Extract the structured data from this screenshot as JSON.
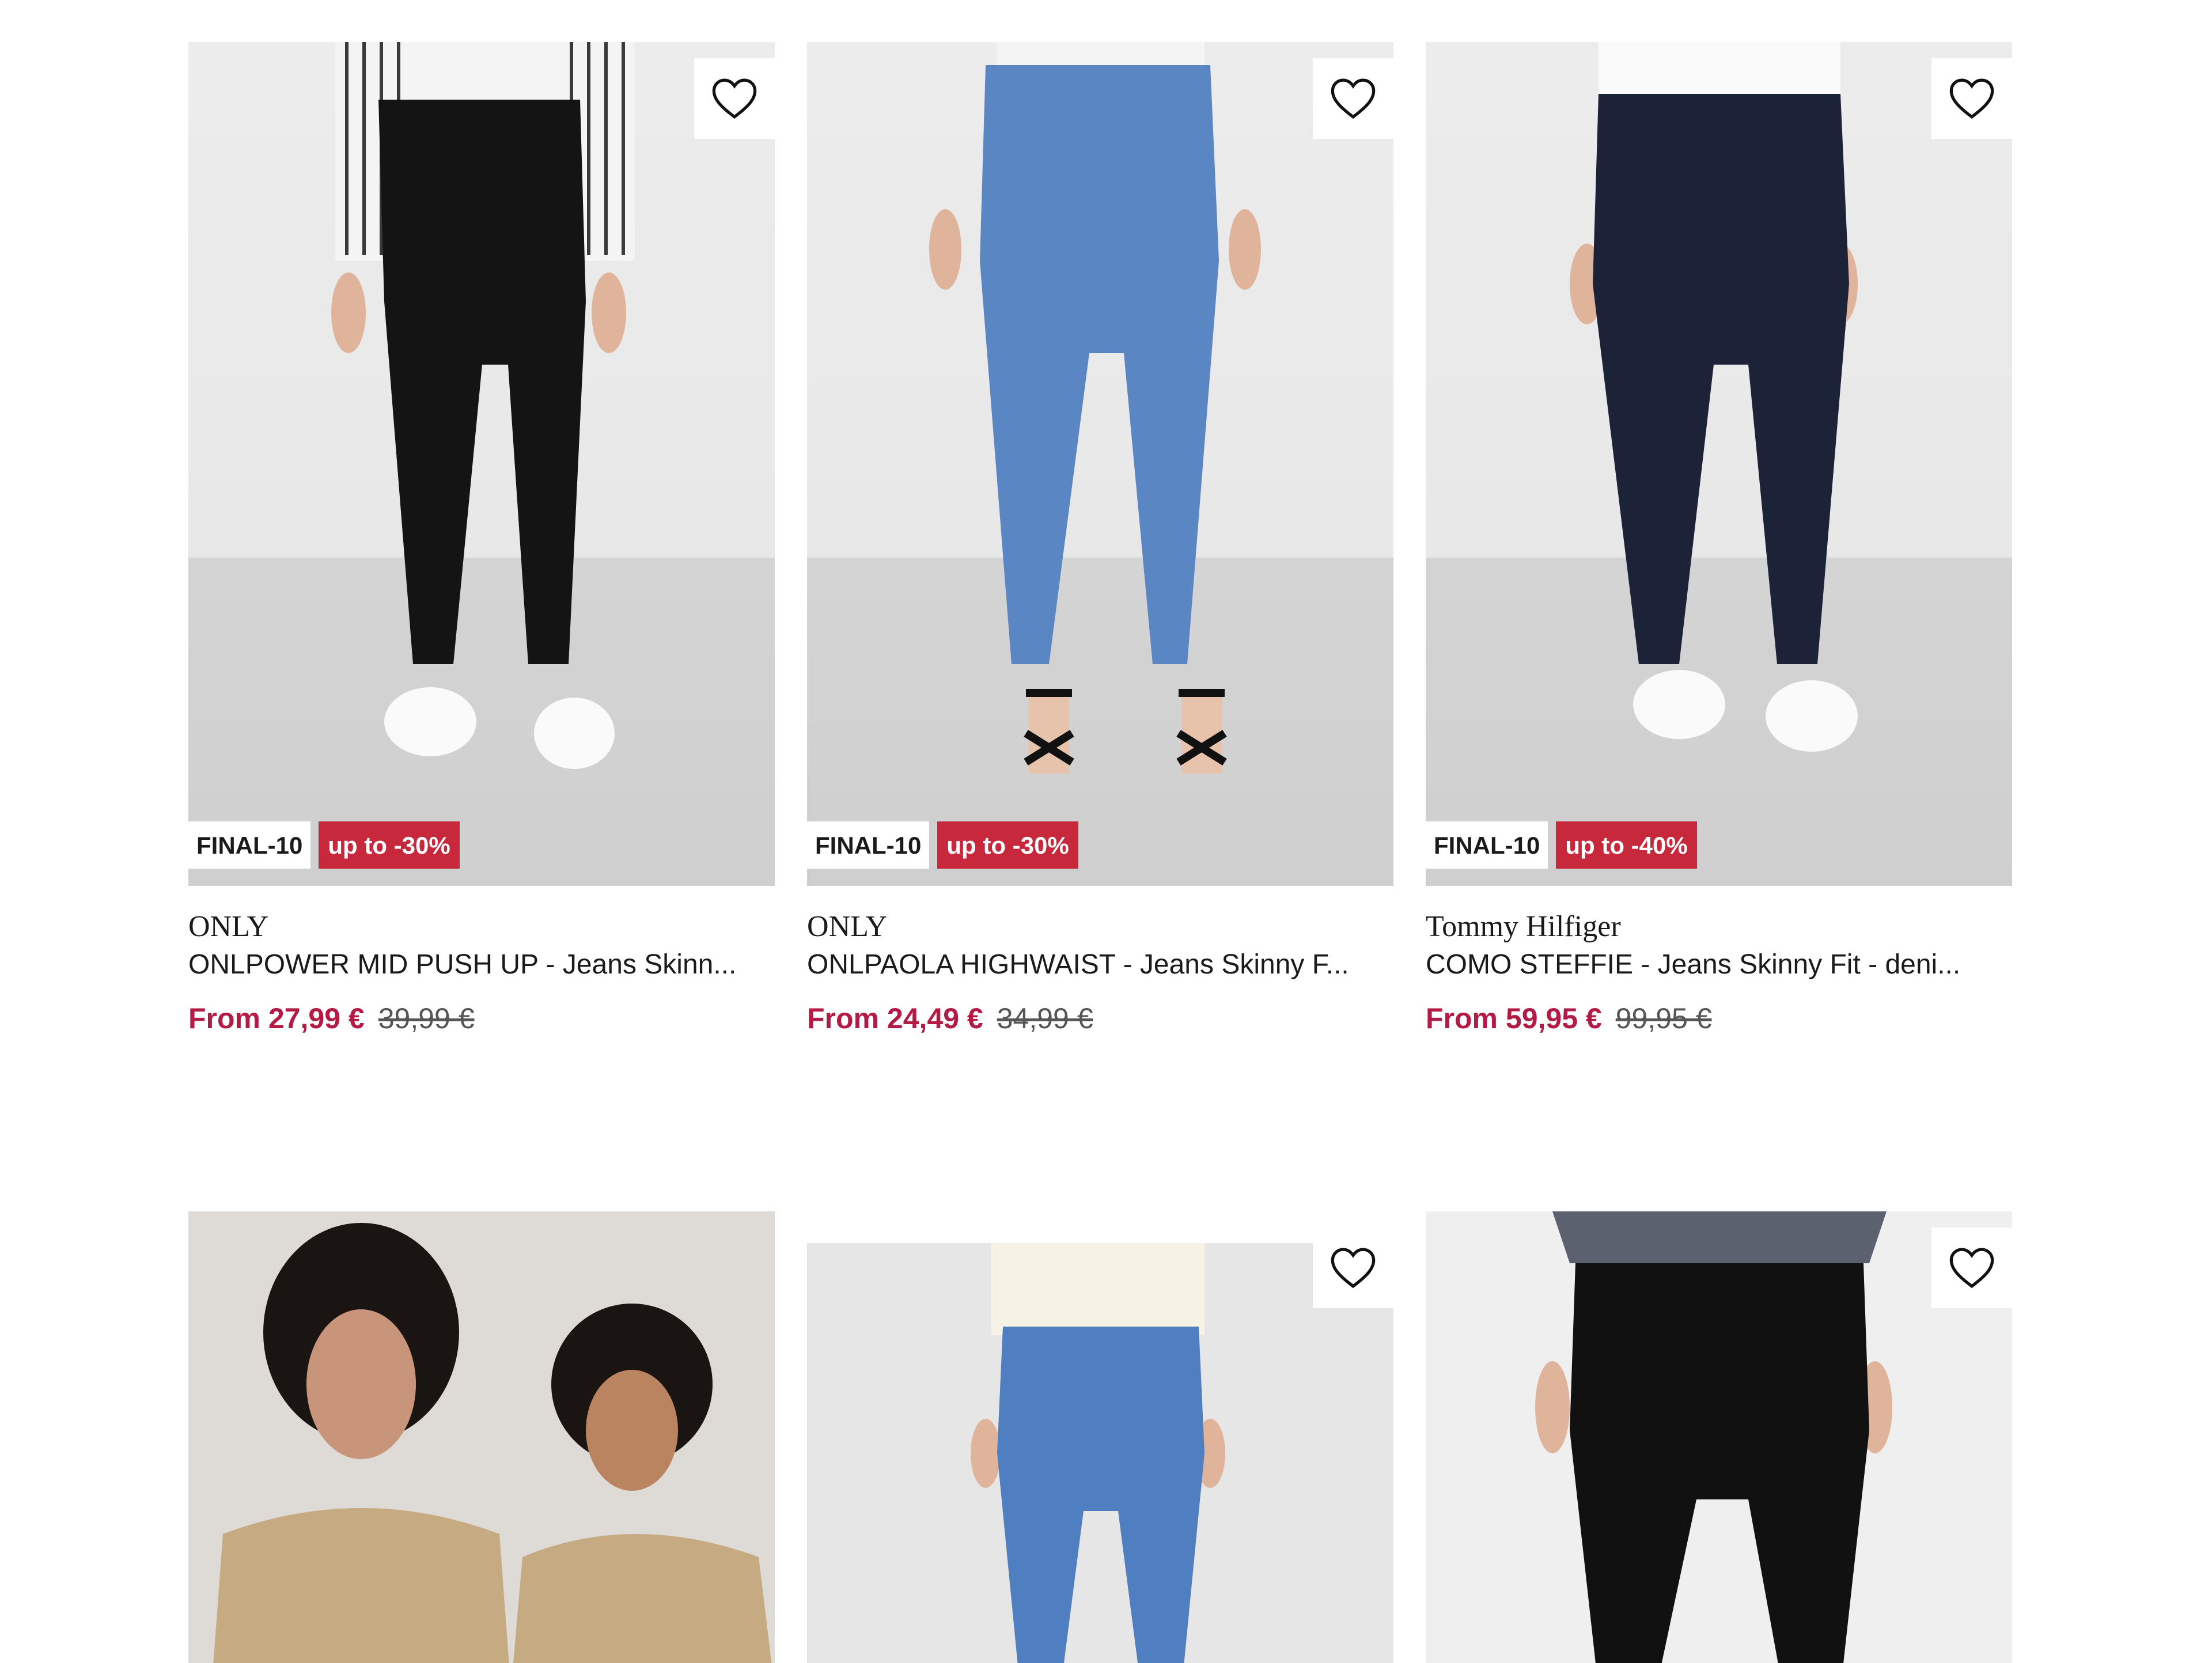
{
  "products": [
    {
      "brand": "ONLY",
      "name": "ONLPOWER MID PUSH UP - Jeans Skinn...",
      "badge_code": "FINAL-10",
      "badge_discount": "up to -30%",
      "price_from": "From 27,99 €",
      "price_old": "39,99 €",
      "jeans_color": "#141414"
    },
    {
      "brand": "ONLY",
      "name": "ONLPAOLA HIGHWAIST - Jeans Skinny F...",
      "badge_code": "FINAL-10",
      "badge_discount": "up to -30%",
      "price_from": "From 24,49 €",
      "price_old": "34,99 €",
      "jeans_color": "#5b86c4"
    },
    {
      "brand": "Tommy Hilfiger",
      "name": "COMO STEFFIE - Jeans Skinny Fit - deni...",
      "badge_code": "FINAL-10",
      "badge_discount": "up to -40%",
      "price_from": "From 59,95 €",
      "price_old": "99,95 €",
      "jeans_color": "#1c2238"
    }
  ],
  "row2": [
    {
      "type": "promo",
      "has_wishlist": false
    },
    {
      "type": "product",
      "has_wishlist": true,
      "jeans_color": "#4f7fc0"
    },
    {
      "type": "product",
      "has_wishlist": true,
      "jeans_color": "#111111"
    }
  ],
  "icons": {
    "wishlist": "heart-outline-icon"
  },
  "colors": {
    "price_accent": "#b31b45",
    "discount_badge": "#c8283b"
  }
}
